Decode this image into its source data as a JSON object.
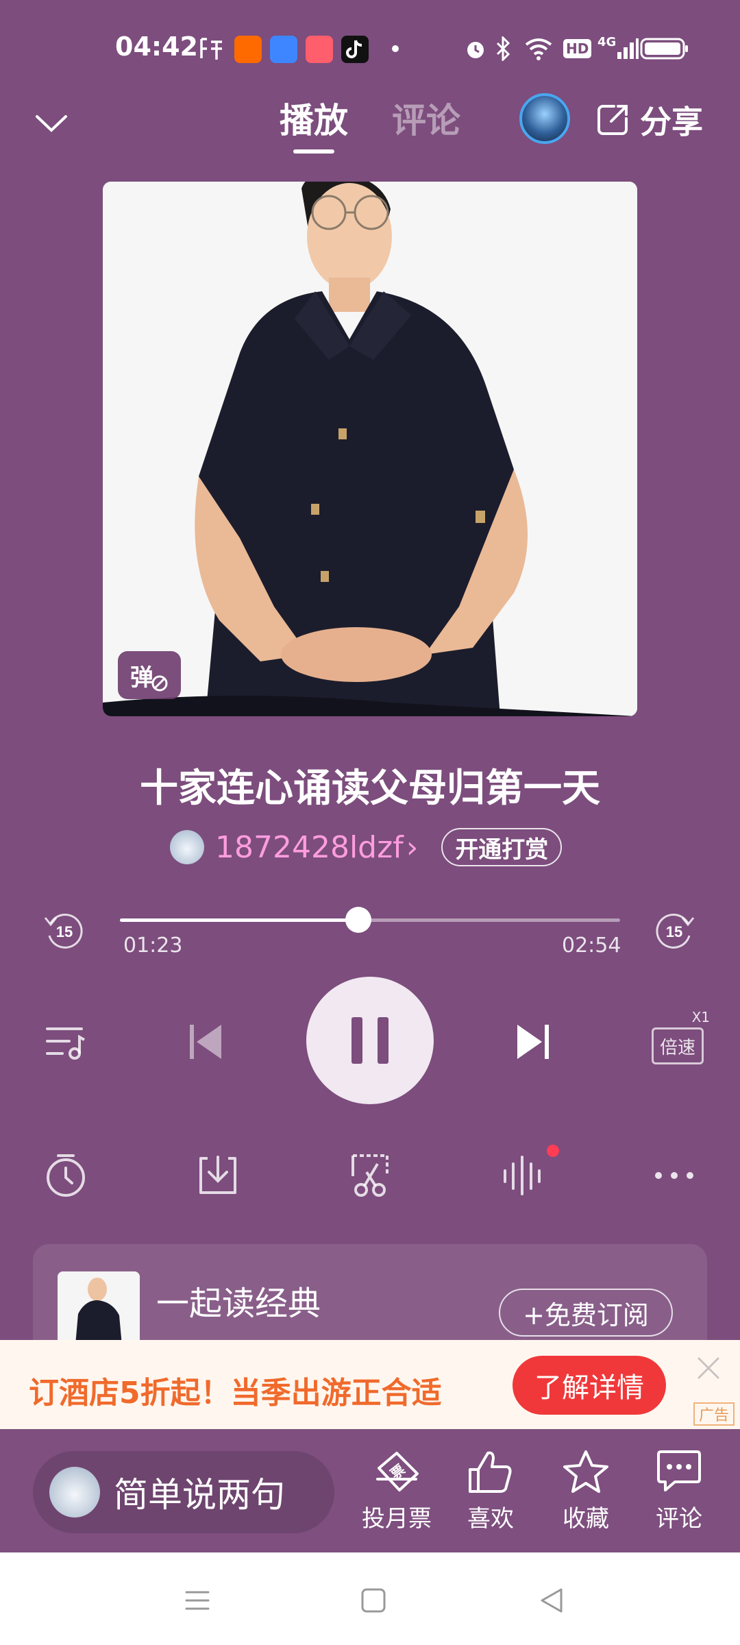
{
  "status_bar": {
    "time": "04:42",
    "network": "4G",
    "hd": "HD"
  },
  "header": {
    "tabs": [
      {
        "label": "播放",
        "active": true
      },
      {
        "label": "评论",
        "active": false
      }
    ],
    "share_label": "分享"
  },
  "cover": {
    "danmaku_label": "弹"
  },
  "track": {
    "title": "十家连心诵读父母归第一天",
    "author": "1872428ldzf",
    "author_chevron": "›",
    "reward_label": "开通打赏"
  },
  "player": {
    "current_time": "01:23",
    "total_time": "02:54",
    "progress": 0.477,
    "skip_back_label": "15",
    "skip_forward_label": "15",
    "speed_label": "倍速",
    "speed_value": "X1"
  },
  "album": {
    "name": "一起读经典",
    "subscribe_label": "+免费订阅"
  },
  "ad": {
    "text": "订酒店5折起！当季出游正合适",
    "cta_label": "了解详情",
    "tag": "广告"
  },
  "bottom_bar": {
    "comment_placeholder": "简单说两句",
    "actions": [
      {
        "label": "投月票",
        "icon": "ticket-icon"
      },
      {
        "label": "喜欢",
        "icon": "thumbs-up-icon"
      },
      {
        "label": "收藏",
        "icon": "star-icon"
      },
      {
        "label": "评论",
        "icon": "comment-icon"
      }
    ]
  },
  "colors": {
    "background": "#7c4d7d",
    "author": "#ff9de0",
    "ad_text": "#f06a2c",
    "ad_cta": "#f0383a"
  }
}
